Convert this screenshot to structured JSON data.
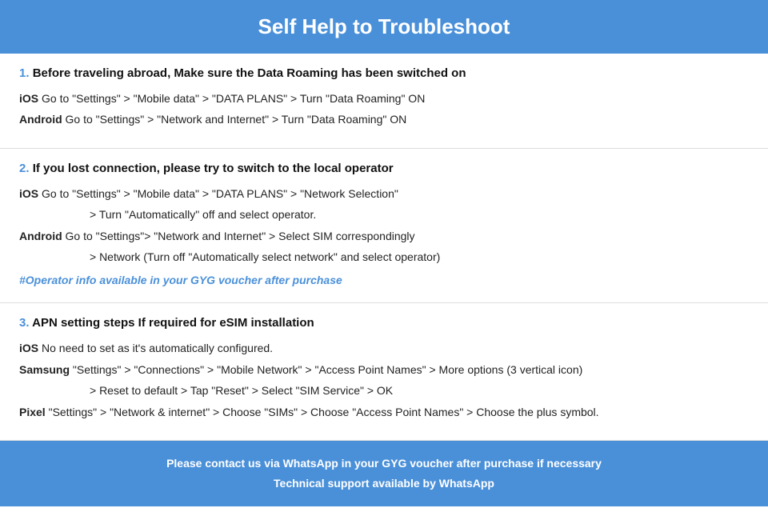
{
  "header": {
    "title": "Self Help to Troubleshoot"
  },
  "sections": [
    {
      "id": "section-1",
      "number": "1.",
      "title": "Before traveling abroad, Make sure the Data Roaming has been switched on",
      "items": [
        {
          "platform": "iOS",
          "text": "   Go to \"Settings\" > \"Mobile data\" > \"DATA PLANS\" > Turn \"Data Roaming\" ON",
          "continuation": null
        },
        {
          "platform": "Android",
          "text": "   Go to \"Settings\" > \"Network and Internet\" > Turn \"Data Roaming\" ON",
          "continuation": null
        }
      ],
      "link": null
    },
    {
      "id": "section-2",
      "number": "2.",
      "title": "If you lost connection, please try to switch to the local operator",
      "items": [
        {
          "platform": "iOS",
          "text": "   Go to \"Settings\" > \"Mobile data\" > \"DATA PLANS\" > \"Network Selection\"",
          "continuation": "> Turn \"Automatically\" off and select operator."
        },
        {
          "platform": "Android",
          "text": "   Go to \"Settings\">  \"Network and Internet\" > Select SIM correspondingly",
          "continuation": "> Network (Turn off \"Automatically select network\" and select operator)"
        }
      ],
      "link": "#Operator info available in your GYG voucher after purchase"
    },
    {
      "id": "section-3",
      "number": "3.",
      "title": "APN setting steps If required for eSIM installation",
      "items": [
        {
          "platform": "iOS",
          "text": "   No need to set as it's automatically configured.",
          "continuation": null
        },
        {
          "platform": "Samsung",
          "text": "   \"Settings\" > \"Connections\" > \"Mobile Network\" > \"Access Point Names\" > More options (3 vertical icon)",
          "continuation": "> Reset to default > Tap \"Reset\" > Select \"SIM Service\" > OK"
        },
        {
          "platform": "Pixel",
          "text": "   \"Settings\" > \"Network & internet\" > Choose \"SIMs\" > Choose \"Access Point Names\" > Choose the plus symbol.",
          "continuation": null
        }
      ],
      "link": null
    }
  ],
  "footer": {
    "line1": "Please contact us via WhatsApp  in your GYG voucher after purchase if necessary",
    "line2": "Technical support available by WhatsApp"
  }
}
